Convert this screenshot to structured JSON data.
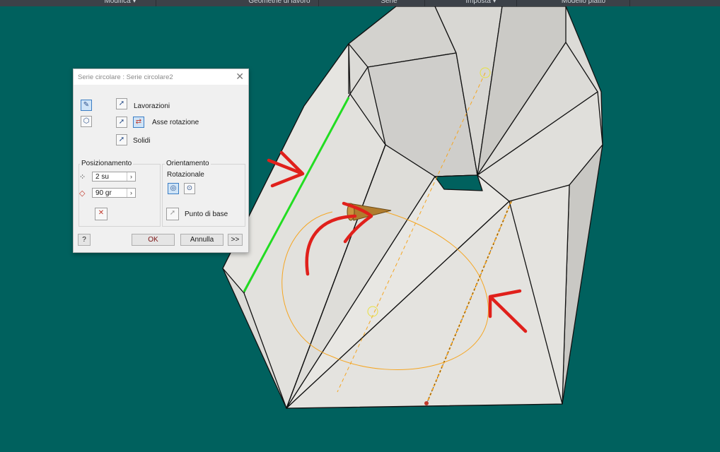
{
  "ribbon": {
    "tabs": [
      "Modifica ▾",
      "Geometrie di lavoro",
      "Serie",
      "Imposta ▾",
      "Modello piatto"
    ]
  },
  "dialog": {
    "title": "Serie circolare : Serie circolare2",
    "close_icon": "close-icon",
    "features_label": "Lavorazioni",
    "axis_label": "Asse rotazione",
    "solids_label": "Solidi",
    "placement": {
      "title": "Posizionamento",
      "count_value": "2 su",
      "angle_value": "90 gr"
    },
    "orientation": {
      "title": "Orientamento",
      "subtitle": "Rotazionale",
      "base_point_label": "Punto di base"
    },
    "help_label": "?",
    "ok_label": "OK",
    "cancel_label": "Annulla",
    "more_label": ">>"
  },
  "colors": {
    "background": "#00615e",
    "part_face": "#e3e2de",
    "part_edge": "#111111",
    "selected_edge": "#22dd22",
    "axis_dashed": "#f5a623",
    "annotation": "#e0201b",
    "preview_cone": "#b07c2e"
  }
}
